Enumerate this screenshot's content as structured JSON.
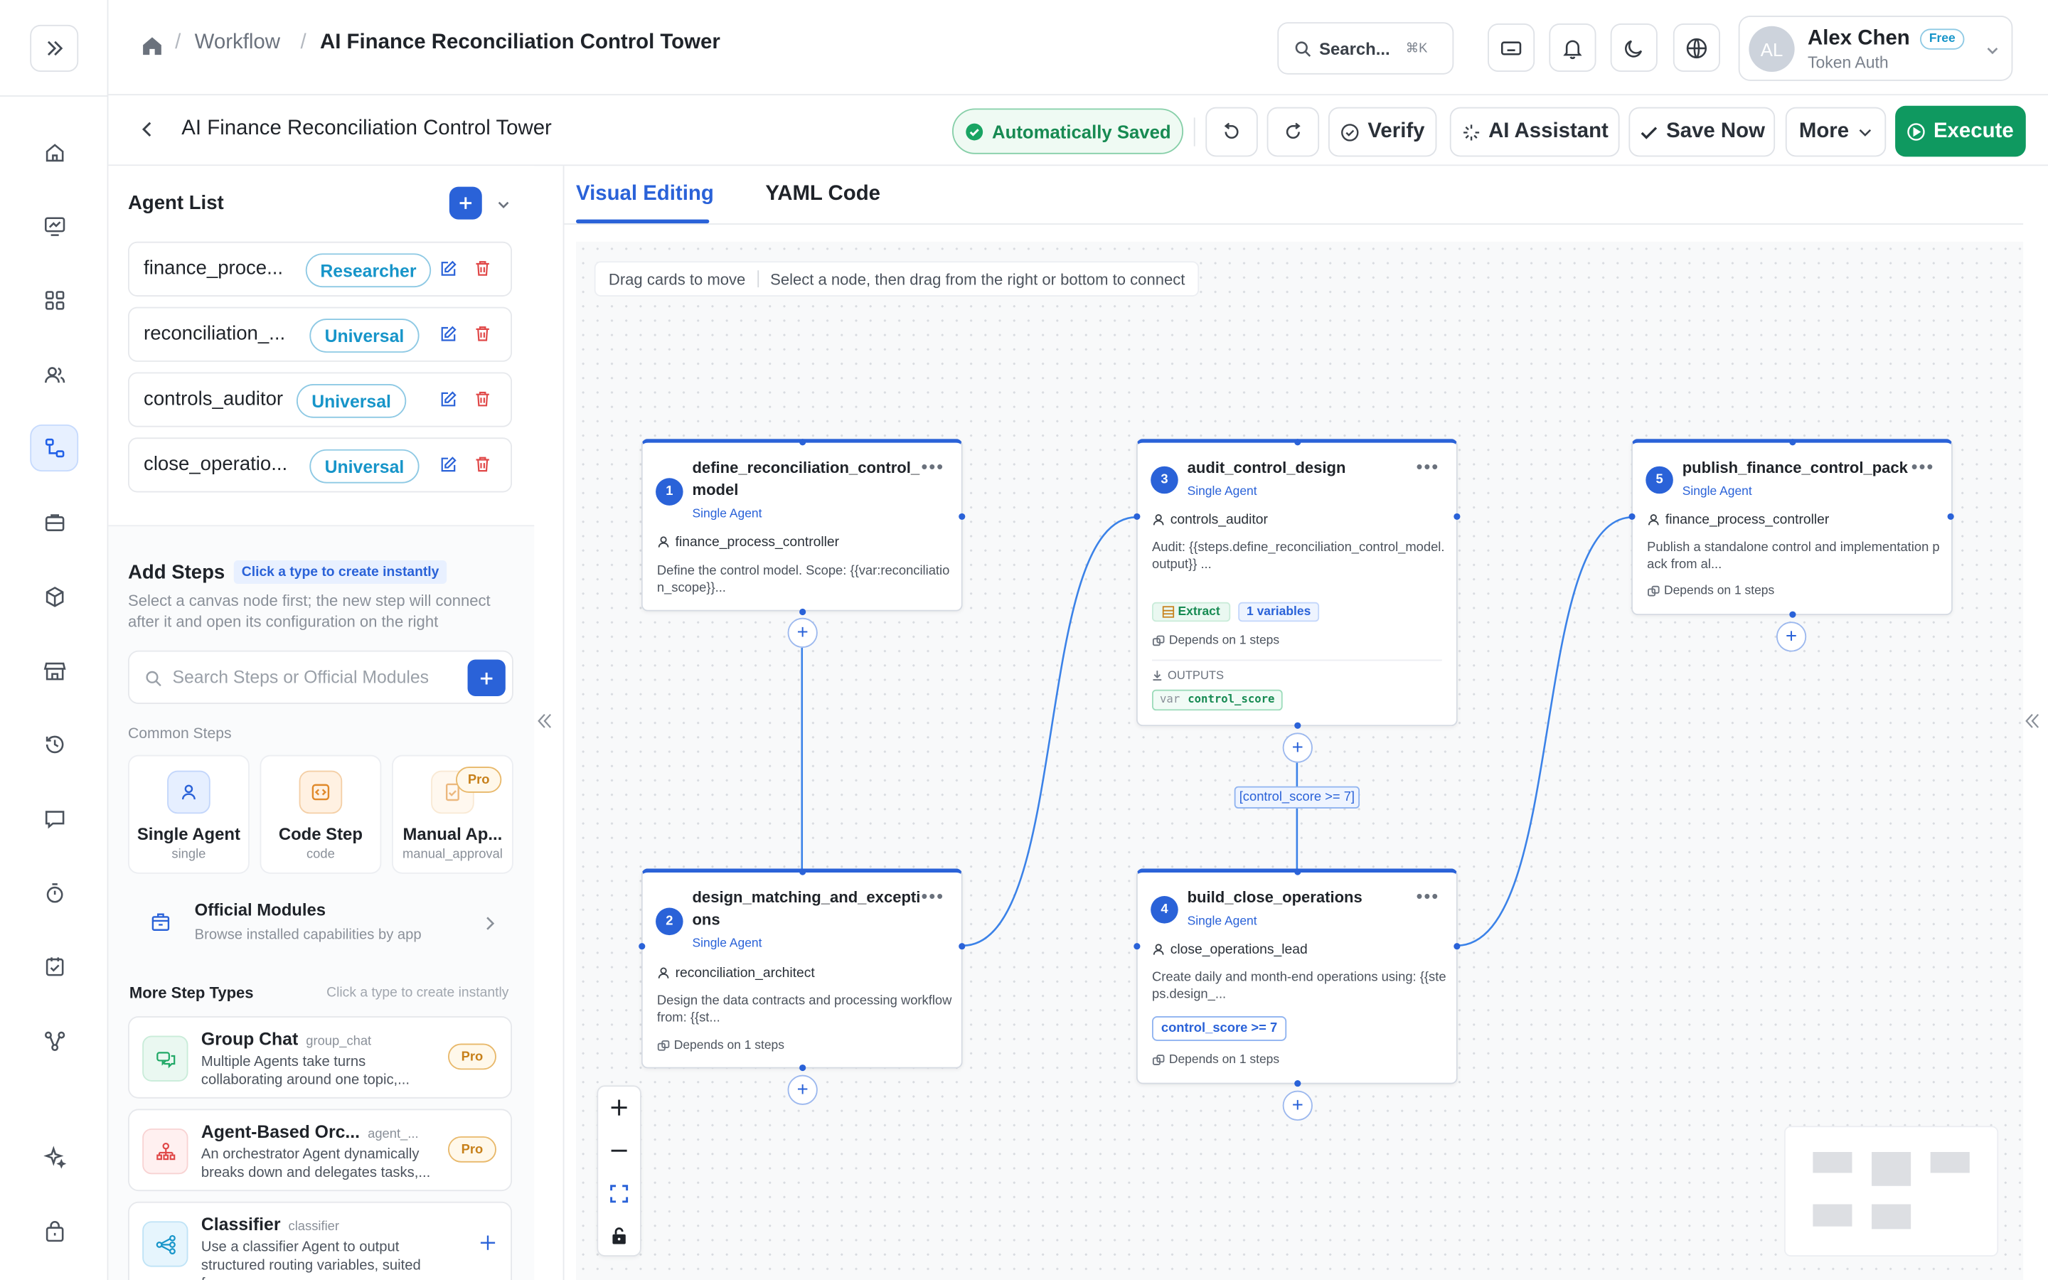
{
  "breadcrumb": {
    "workflow": "Workflow",
    "current": "AI Finance Reconciliation Control Tower"
  },
  "header": {
    "search_label": "Search...",
    "search_shortcut": "⌘K",
    "user_initials": "AL",
    "user_name": "Alex Chen",
    "user_plan": "Free",
    "user_auth": "Token Auth"
  },
  "toolbar": {
    "page_title": "AI Finance Reconciliation Control Tower",
    "saved_status": "Automatically Saved",
    "verify_label": "Verify",
    "ai_label": "AI Assistant",
    "save_label": "Save Now",
    "more_label": "More",
    "execute_label": "Execute"
  },
  "agent_list": {
    "title": "Agent List",
    "agents": [
      {
        "name": "finance_proce...",
        "role": "Researcher"
      },
      {
        "name": "reconciliation_...",
        "role": "Universal"
      },
      {
        "name": "controls_auditor",
        "role": "Universal"
      },
      {
        "name": "close_operatio...",
        "role": "Universal"
      }
    ]
  },
  "add_steps": {
    "title": "Add Steps",
    "badge": "Click a type to create instantly",
    "desc": "Select a canvas node first; the new step will connect after it and open its configuration on the right",
    "search_placeholder": "Search Steps or Official Modules",
    "common_label": "Common Steps",
    "common": [
      {
        "title": "Single Agent",
        "sub": "single"
      },
      {
        "title": "Code Step",
        "sub": "code"
      },
      {
        "title": "Manual Ap...",
        "sub": "manual_approval",
        "pro": "Pro"
      }
    ],
    "official_title": "Official Modules",
    "official_desc": "Browse installed capabilities by app",
    "more_label": "More Step Types",
    "more_hint": "Click a type to create instantly",
    "more": [
      {
        "title": "Group Chat",
        "tag": "group_chat",
        "desc": "Multiple Agents take turns collaborating around one topic,...",
        "pro": "Pro"
      },
      {
        "title": "Agent-Based Orc...",
        "tag": "agent_...",
        "desc": "An orchestrator Agent dynamically breaks down and delegates tasks,...",
        "pro": "Pro"
      },
      {
        "title": "Classifier",
        "tag": "classifier",
        "desc": "Use a classifier Agent to output structured routing variables, suited for..."
      }
    ]
  },
  "editor": {
    "tab_visual": "Visual Editing",
    "tab_yaml": "YAML Code",
    "hint_drag": "Drag cards to move",
    "hint_connect": "Select a node, then drag from the right or bottom to connect"
  },
  "nodes": [
    {
      "num": "1",
      "title": "define_reconciliation_control_model",
      "type": "Single Agent",
      "owner": "finance_process_controller",
      "desc": "Define the control model. Scope: {{var:reconciliation_scope}}..."
    },
    {
      "num": "2",
      "title": "design_matching_and_exceptions",
      "type": "Single Agent",
      "owner": "reconciliation_architect",
      "desc": "Design the data contracts and processing workflow from: {{st...",
      "dep": "Depends on 1 steps"
    },
    {
      "num": "3",
      "title": "audit_control_design",
      "type": "Single Agent",
      "owner": "controls_auditor",
      "desc": "Audit: {{steps.define_reconciliation_control_model.output}} ...",
      "chip_extract": "Extract",
      "chip_vars": "1 variables",
      "dep": "Depends on 1 steps",
      "outputs_label": "OUTPUTS",
      "out_var": "var",
      "out_name": "control_score"
    },
    {
      "num": "4",
      "title": "build_close_operations",
      "type": "Single Agent",
      "owner": "close_operations_lead",
      "desc": "Create daily and month-end operations using: {{steps.design_...",
      "cond": "control_score >= 7",
      "dep": "Depends on 1 steps"
    },
    {
      "num": "5",
      "title": "publish_finance_control_pack",
      "type": "Single Agent",
      "owner": "finance_process_controller",
      "desc": "Publish a standalone control and implementation pack from al...",
      "dep": "Depends on 1 steps"
    }
  ],
  "edge_condition": "[control_score >= 7]",
  "colors": {
    "primary": "#2a62d8",
    "success": "#0f9960",
    "pro": "#c7801a"
  }
}
